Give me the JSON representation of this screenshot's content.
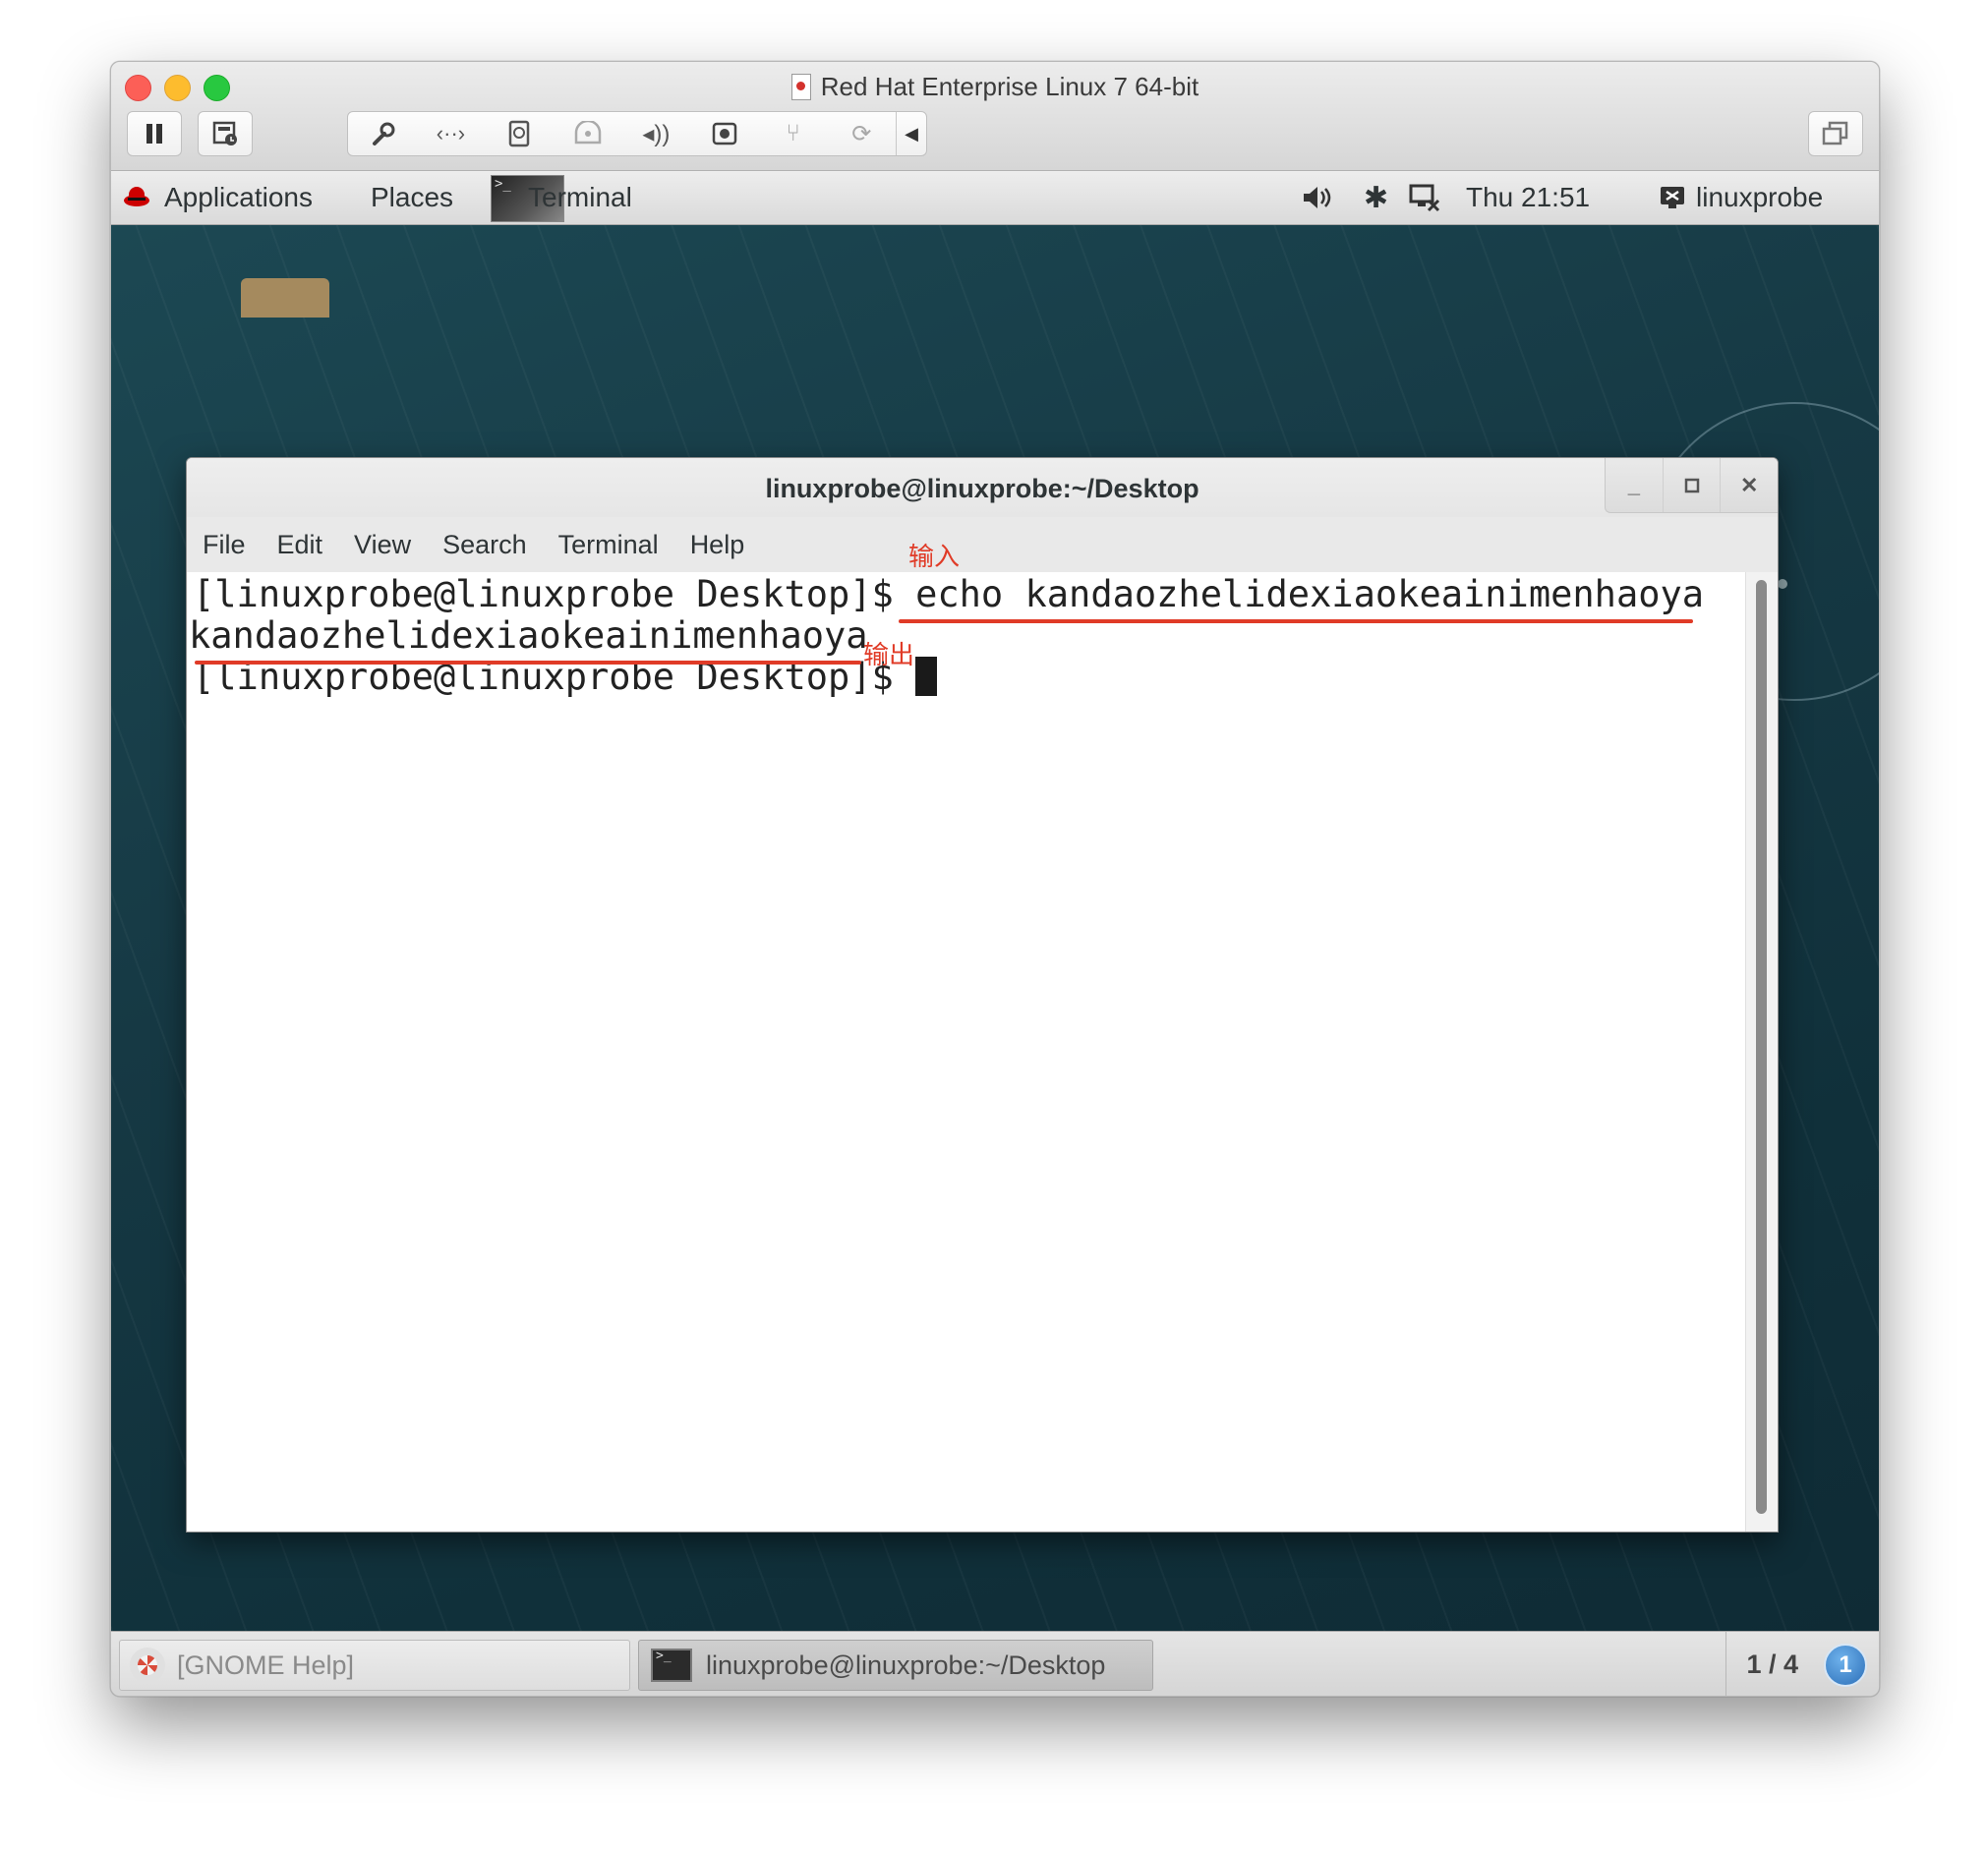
{
  "vmware": {
    "window_title": "Red Hat Enterprise Linux 7 64-bit",
    "toolbar_icons": [
      "pause-icon",
      "snapshot-icon",
      "wrench-icon",
      "network-icon",
      "hard-disk-icon",
      "cd-drive-icon",
      "speaker-icon",
      "camera-icon",
      "usb-icon",
      "sync-icon",
      "chevron-left-icon",
      "unity-icon"
    ]
  },
  "gnome_topbar": {
    "applications": "Applications",
    "places": "Places",
    "active_app": "Terminal",
    "clock": "Thu 21:51",
    "user": "linuxprobe"
  },
  "terminal": {
    "title": "linuxprobe@linuxprobe:~/Desktop",
    "menu": [
      "File",
      "Edit",
      "View",
      "Search",
      "Terminal",
      "Help"
    ],
    "lines": [
      {
        "prompt": "[linuxprobe@linuxprobe Desktop]$ ",
        "command": "echo kandaozhelidexiaokeainimenhaoya"
      },
      {
        "output": "kandaozhelidexiaokeainimenhaoya"
      },
      {
        "prompt": "[linuxprobe@linuxprobe Desktop]$ ",
        "command": ""
      }
    ]
  },
  "annotations": {
    "input_label": "输入",
    "output_label": "输出",
    "color": "#e03b27"
  },
  "gnome_bottombar": {
    "task_help": "[GNOME Help]",
    "task_terminal": "linuxprobe@linuxprobe:~/Desktop",
    "workspace": "1 / 4",
    "notifications": "1"
  }
}
